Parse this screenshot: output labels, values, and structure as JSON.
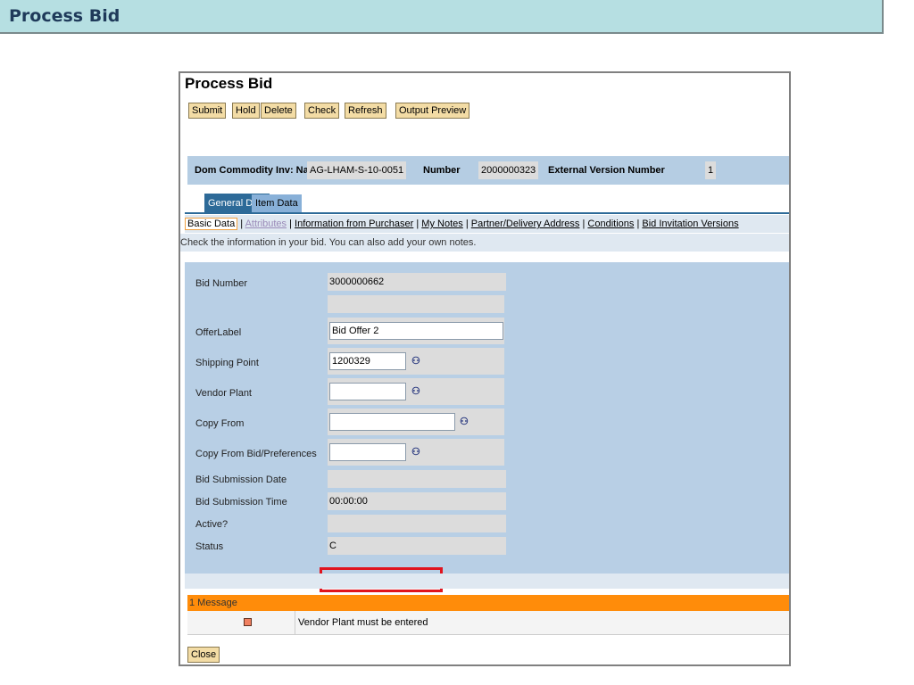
{
  "page_title": "Process Bid",
  "window": {
    "title": "Process Bid",
    "buttons": [
      "Submit",
      "Hold",
      "Delete",
      "Check",
      "Refresh",
      "Output Preview"
    ],
    "header": {
      "name_label": "Dom Commodity Inv: Name",
      "name_value": "AG-LHAM-S-10-0051",
      "number_label": "Number",
      "number_value": "2000000323",
      "ext_label": "External Version Number",
      "ext_value": "1"
    },
    "tabs": [
      "General Data",
      "Item Data"
    ],
    "subtabs": [
      "Basic Data",
      "Attributes",
      "Information from Purchaser",
      "My Notes",
      "Partner/Delivery Address",
      "Conditions",
      "Bid Invitation Versions"
    ],
    "hint": "Check the information in your bid. You can also add your own notes.",
    "fields": {
      "bid_number": {
        "label": "Bid Number",
        "value": "3000000662"
      },
      "offer_label": {
        "label": "OfferLabel",
        "value": "Bid Offer 2"
      },
      "shipping_point": {
        "label": "Shipping Point",
        "value": "1200329"
      },
      "vendor_plant": {
        "label": "Vendor Plant",
        "value": ""
      },
      "copy_from": {
        "label": "Copy From",
        "value": ""
      },
      "copy_from_bid": {
        "label": "Copy From Bid/Preferences",
        "value": ""
      },
      "submission_date": {
        "label": "Bid Submission Date",
        "value": ""
      },
      "submission_time": {
        "label": "Bid Submission Time",
        "value": "00:00:00"
      },
      "active": {
        "label": "Active?",
        "value": ""
      },
      "status": {
        "label": "Status",
        "value": "C"
      }
    },
    "messages": {
      "header": "1 Message",
      "items": [
        "Vendor Plant must be entered"
      ]
    },
    "close_label": "Close"
  }
}
